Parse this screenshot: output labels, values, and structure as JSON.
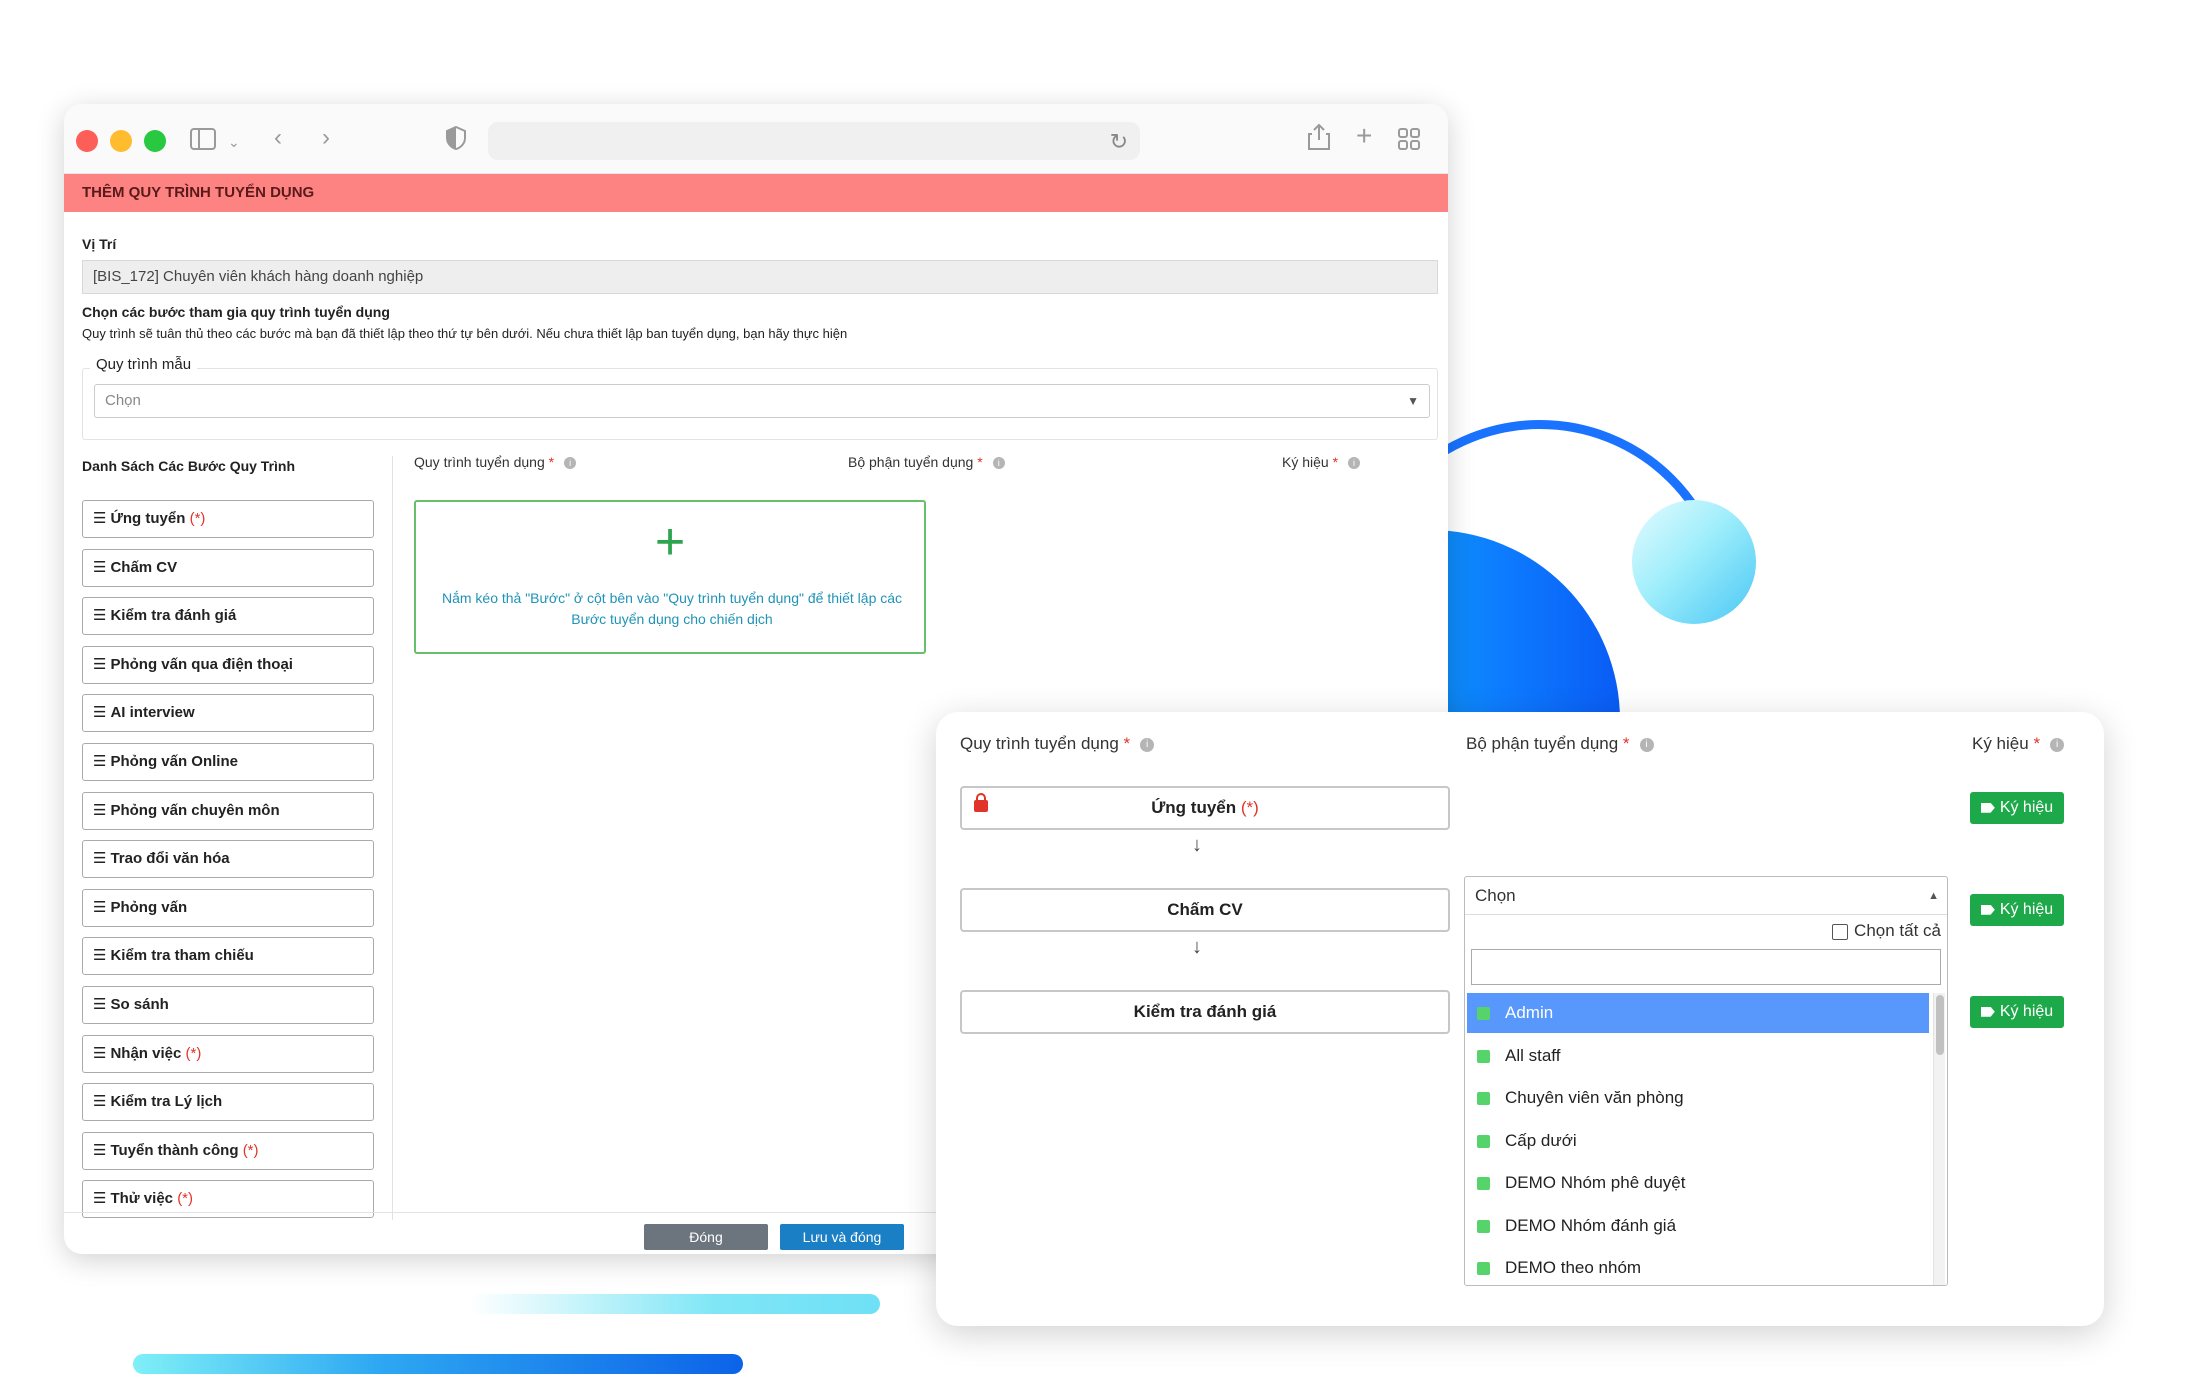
{
  "modal": {
    "title": "THÊM QUY TRÌNH TUYỂN DỤNG",
    "position_label": "Vị Trí",
    "position_value": "[BIS_172] Chuyên viên khách hàng doanh nghiệp",
    "choose_steps_label": "Chọn các bước tham gia quy trình tuyển dụng",
    "choose_steps_hint": "Quy trình sẽ tuân thủ theo các bước mà bạn đã thiết lập theo thứ tự bên dưới. Nếu chưa thiết lập ban tuyển dụng, bạn hãy thực hiện",
    "template_label": "Quy trình mẫu",
    "template_placeholder": "Chọn",
    "steps_list_title": "Danh Sách Các Bước Quy Trình",
    "steps": [
      {
        "label": "Ứng tuyển",
        "req": "(*)"
      },
      {
        "label": "Chấm CV",
        "req": ""
      },
      {
        "label": "Kiểm tra đánh giá",
        "req": ""
      },
      {
        "label": "Phỏng vấn qua điện thoại",
        "req": ""
      },
      {
        "label": "AI interview",
        "req": ""
      },
      {
        "label": "Phỏng vấn Online",
        "req": ""
      },
      {
        "label": "Phỏng vấn chuyên môn",
        "req": ""
      },
      {
        "label": "Trao đổi văn hóa",
        "req": ""
      },
      {
        "label": "Phỏng vấn",
        "req": ""
      },
      {
        "label": "Kiểm tra tham chiếu",
        "req": ""
      },
      {
        "label": "So sánh",
        "req": ""
      },
      {
        "label": "Nhận việc",
        "req": "(*)"
      },
      {
        "label": "Kiểm tra Lý lịch",
        "req": ""
      },
      {
        "label": "Tuyển thành công",
        "req": "(*)"
      },
      {
        "label": "Thử việc",
        "req": "(*)"
      }
    ],
    "columns": {
      "process": "Quy trình tuyển dụng",
      "department": "Bộ phận tuyển dụng",
      "symbol": "Ký hiệu",
      "required_mark": "*"
    },
    "dropzone_plus": "+",
    "dropzone_text": "Nắm kéo thả \"Bước\" ở cột bên vào \"Quy trình tuyển dụng\" để thiết lập các Bước tuyển dụng cho chiến dịch",
    "close_button": "Đóng",
    "save_button": "Lưu và đóng"
  },
  "card": {
    "flow": [
      {
        "label": "Ứng tuyển",
        "req": "(*)",
        "locked": true
      },
      {
        "label": "Chấm CV",
        "req": "",
        "locked": false
      },
      {
        "label": "Kiểm tra đánh giá",
        "req": "",
        "locked": false
      }
    ],
    "arrow": "↓",
    "tag_button": "Ký hiệu",
    "dropdown": {
      "selected_text": "Chọn",
      "select_all_label": "Chọn tất cả",
      "search_value": "",
      "options": [
        "Admin",
        "All staff",
        "Chuyên viên văn phòng",
        "Cấp dưới",
        "DEMO Nhóm phê duyệt",
        "DEMO Nhóm đánh giá",
        "DEMO theo nhóm"
      ],
      "highlighted": "Admin"
    }
  },
  "colors": {
    "modal_header_bg": "#fd8383",
    "accent_green": "#1da84a",
    "primary_blue": "#1a7fc5",
    "highlight_blue": "#5897fb",
    "required_red": "#e0342a"
  },
  "icons": [
    "sidebar-icon",
    "chevron-down-icon",
    "back-icon",
    "forward-icon",
    "shield-icon",
    "reload-icon",
    "share-icon",
    "new-tab-icon",
    "tab-overview-icon",
    "lock-icon",
    "tag-icon",
    "info-icon",
    "drag-handle-icon"
  ]
}
